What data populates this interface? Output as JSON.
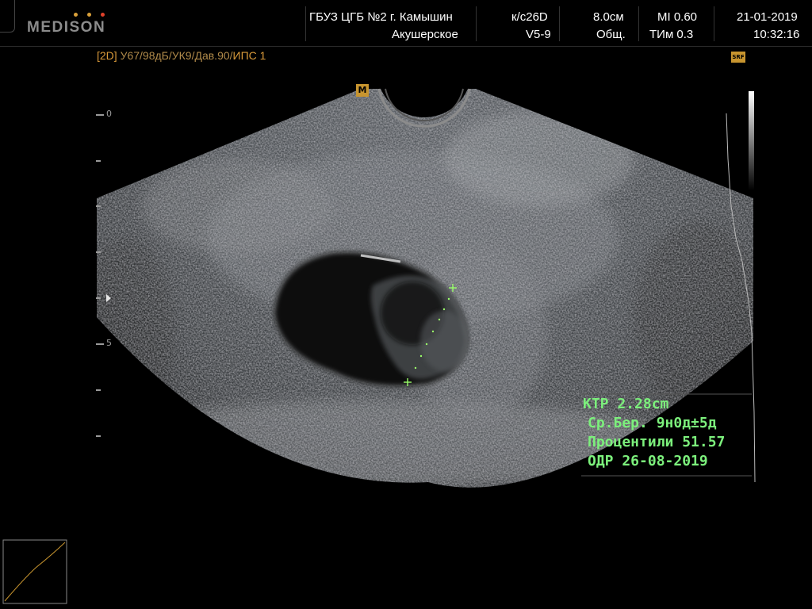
{
  "logo": {
    "brand": "MEDISON",
    "dots": [
      "#d9a03a",
      "#d9a03a",
      "#e0402a"
    ]
  },
  "header": {
    "institution": "ГБУЗ ЦГБ №2 г. Камышин",
    "department": "Акушерское",
    "frame_rate": "к/с26D",
    "probe": "V5-9",
    "depth": "8.0см",
    "preset": "Общ.",
    "mi": "MI  0.60",
    "tim": "ТИм 0.3",
    "date": "21-01-2019",
    "time": "10:32:16"
  },
  "imaging_params": {
    "mode": "[2D]",
    "gain_settings": " У67/98дБ/УК9/Дав.90/",
    "ips": "ИПС 1"
  },
  "badges": {
    "m_marker": "M",
    "srf": "SRF"
  },
  "depth_scale": {
    "labels": [
      "0",
      "5"
    ]
  },
  "measurement": {
    "crl": "КТР 2.28cm",
    "ga": "Ср.Бер. 9н0д±5д",
    "percentile": "Процентили 51.57",
    "edd": "ОДР 26-08-2019"
  },
  "colors": {
    "measurement_text": "#7cf07c",
    "param_text": "#d99a3a",
    "caliper": "#9aff6a"
  }
}
